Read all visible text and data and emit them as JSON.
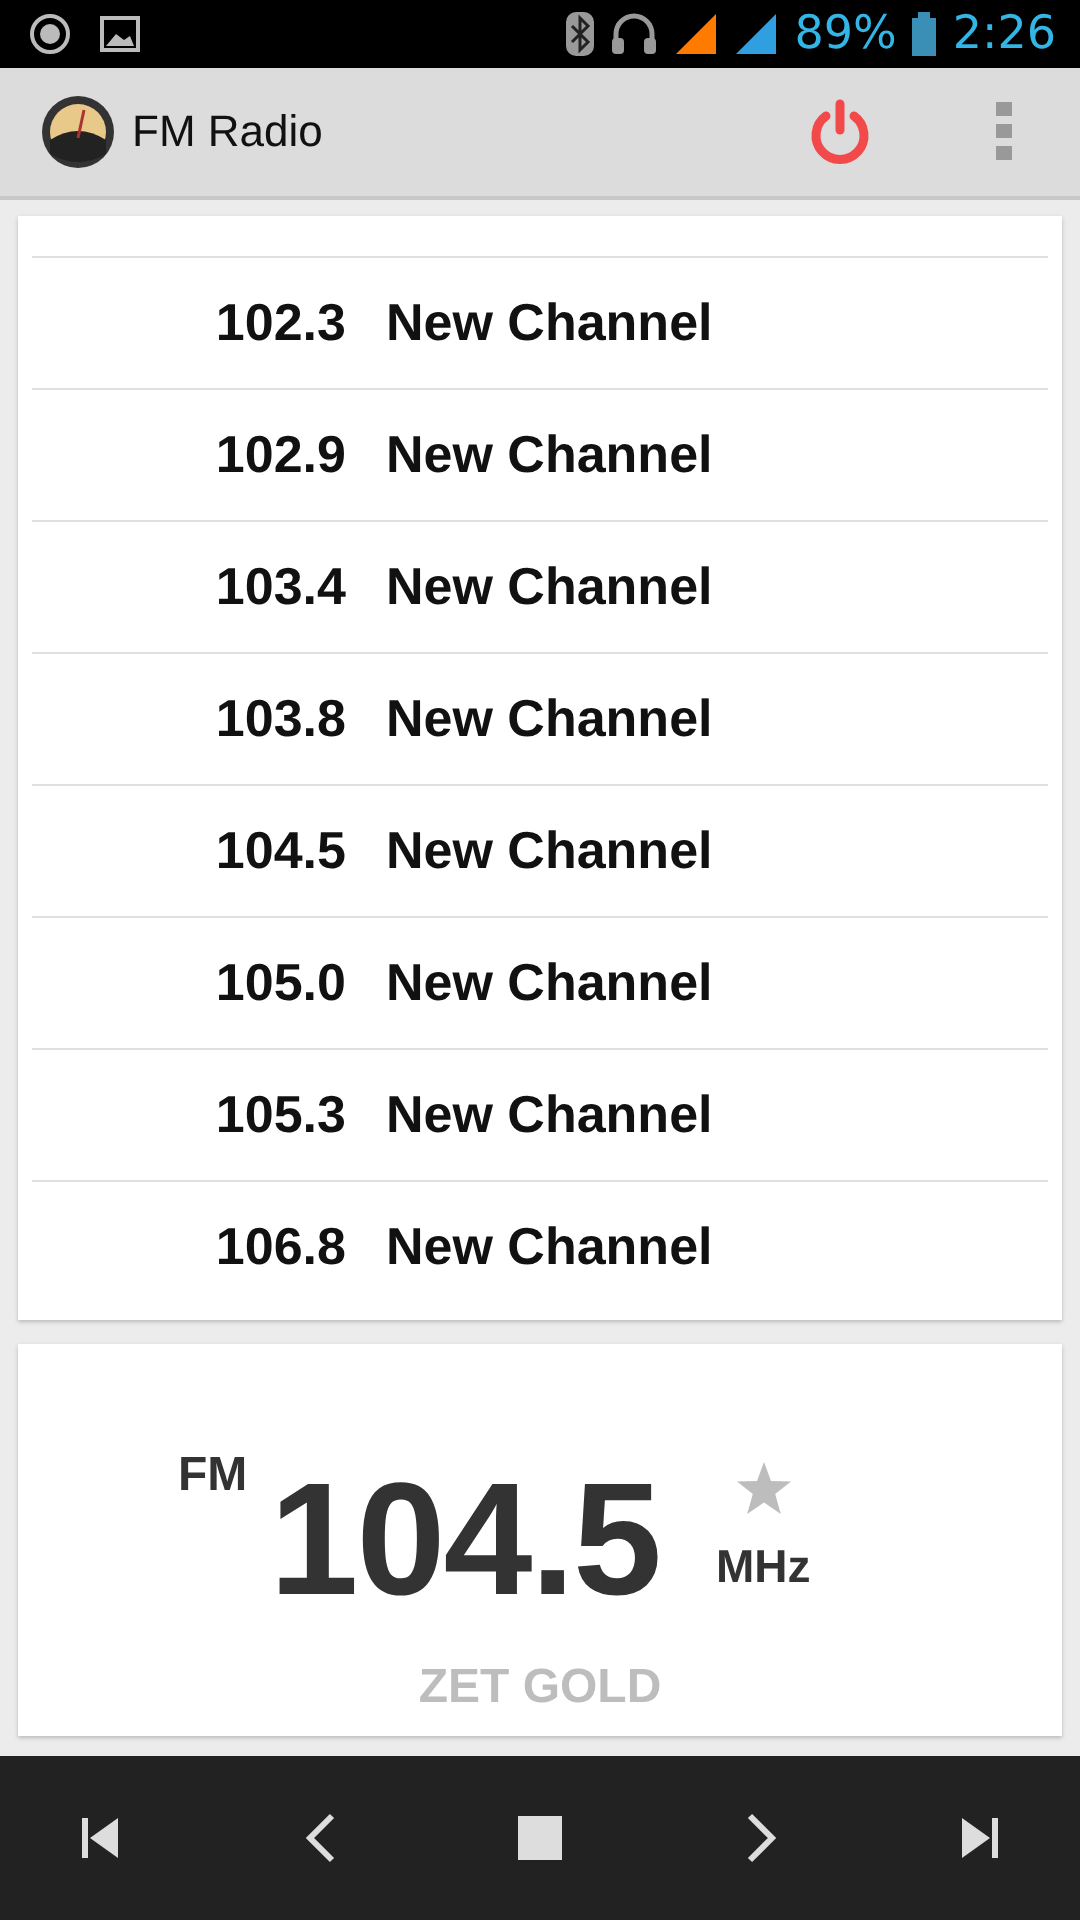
{
  "status_bar": {
    "battery": "89%",
    "time": "2:26"
  },
  "app_bar": {
    "title": "FM Radio"
  },
  "channels": [
    {
      "frequency": "102.3",
      "name": "New Channel"
    },
    {
      "frequency": "102.9",
      "name": "New Channel"
    },
    {
      "frequency": "103.4",
      "name": "New Channel"
    },
    {
      "frequency": "103.8",
      "name": "New Channel"
    },
    {
      "frequency": "104.5",
      "name": "New Channel"
    },
    {
      "frequency": "105.0",
      "name": "New Channel"
    },
    {
      "frequency": "105.3",
      "name": "New Channel"
    },
    {
      "frequency": "106.8",
      "name": "New Channel"
    }
  ],
  "now_playing": {
    "band": "FM",
    "frequency": "104.5",
    "unit": "MHz",
    "station": "ZET GOLD",
    "favorite": false
  }
}
